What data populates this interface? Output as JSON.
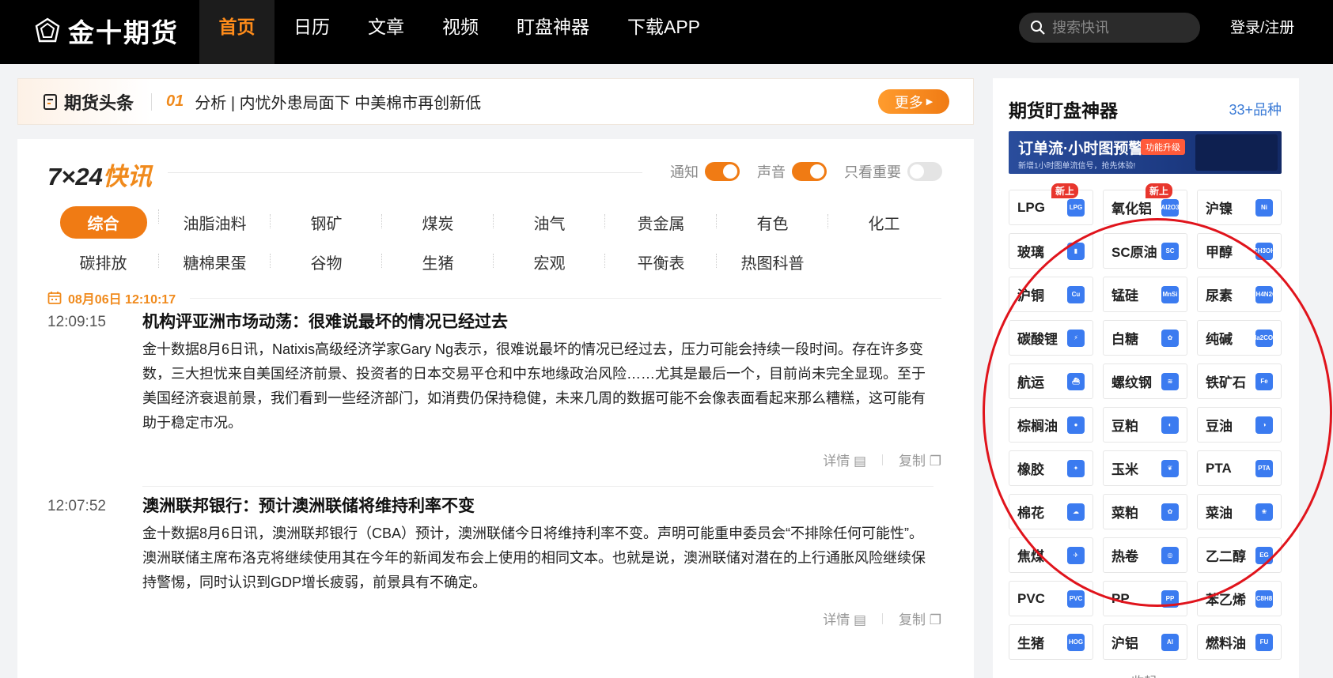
{
  "logo": {
    "text": "金十期货"
  },
  "nav": {
    "items": [
      {
        "label": "首页",
        "active": true
      },
      {
        "label": "日历"
      },
      {
        "label": "文章"
      },
      {
        "label": "视频"
      },
      {
        "label": "盯盘神器"
      },
      {
        "label": "下载APP"
      }
    ]
  },
  "search": {
    "placeholder": "搜索快讯"
  },
  "login": "登录/注册",
  "headline": {
    "label": "期货头条",
    "num": "01",
    "text": "分析 | 内忧外患局面下 中美棉市再创新低",
    "more": "更多"
  },
  "flash": {
    "title_a": "7×24",
    "title_b": "快讯",
    "toggles": [
      {
        "label": "通知",
        "on": true
      },
      {
        "label": "声音",
        "on": true
      },
      {
        "label": "只看重要",
        "on": false
      }
    ],
    "categories_row1": [
      "综合",
      "油脂油料",
      "钢矿",
      "煤炭",
      "油气",
      "贵金属",
      "有色",
      "化工"
    ],
    "categories_row2": [
      "碳排放",
      "糖棉果蛋",
      "谷物",
      "生猪",
      "宏观",
      "平衡表",
      "热图科普"
    ],
    "date": "08月06日 12:10:17",
    "news": [
      {
        "time": "12:09:15",
        "title": "机构评亚洲市场动荡：很难说最坏的情况已经过去",
        "content": "金十数据8月6日讯，Natixis高级经济学家Gary Ng表示，很难说最坏的情况已经过去，压力可能会持续一段时间。存在许多变数，三大担忧来自美国经济前景、投资者的日本交易平仓和中东地缘政治风险……尤其是最后一个，目前尚未完全显现。至于美国经济衰退前景，我们看到一些经济部门，如消费仍保持稳健，未来几周的数据可能不会像表面看起来那么糟糕，这可能有助于稳定市况。",
        "detail": "详情",
        "copy": "复制"
      },
      {
        "time": "12:07:52",
        "title": "澳洲联邦银行：预计澳洲联储将维持利率不变",
        "content": "金十数据8月6日讯，澳洲联邦银行（CBA）预计，澳洲联储今日将维持利率不变。声明可能重申委员会“不排除任何可能性”。澳洲联储主席布洛克将继续使用其在今年的新闻发布会上使用的相同文本。也就是说，澳洲联储对潜在的上行通胀风险继续保持警惕，同时认识到GDP增长疲弱，前景具有不确定。",
        "detail": "详情",
        "copy": "复制"
      }
    ]
  },
  "side": {
    "title": "期货盯盘神器",
    "count": "33+品种",
    "banner": {
      "title": "订单流·小时图预警",
      "tag": "功能升级",
      "sub": "新增1小时图单流信号，抢先体验!"
    },
    "items": [
      {
        "label": "LPG",
        "icon": "LPG",
        "color": "#3b7bf0",
        "new": "新上"
      },
      {
        "label": "氧化铝",
        "icon": "Al2O3",
        "color": "#3b7bf0",
        "new": "新上"
      },
      {
        "label": "沪镍",
        "icon": "Ni",
        "color": "#3b7bf0"
      },
      {
        "label": "玻璃",
        "icon": "▮",
        "color": "#3b7bf0"
      },
      {
        "label": "SC原油",
        "icon": "SC",
        "color": "#3b7bf0"
      },
      {
        "label": "甲醇",
        "icon": "CH3OH",
        "color": "#3b7bf0"
      },
      {
        "label": "沪铜",
        "icon": "Cu",
        "color": "#3b7bf0"
      },
      {
        "label": "锰硅",
        "icon": "MnSi",
        "color": "#3b7bf0"
      },
      {
        "label": "尿素",
        "icon": "CH4N2O",
        "color": "#3b7bf0"
      },
      {
        "label": "碳酸锂",
        "icon": "⚡",
        "color": "#3b7bf0"
      },
      {
        "label": "白糖",
        "icon": "✿",
        "color": "#3b7bf0"
      },
      {
        "label": "纯碱",
        "icon": "Na2CO3",
        "color": "#3b7bf0"
      },
      {
        "label": "航运",
        "icon": "⛴",
        "color": "#3b7bf0"
      },
      {
        "label": "螺纹钢",
        "icon": "≋",
        "color": "#3b7bf0"
      },
      {
        "label": "铁矿石",
        "icon": "Fe",
        "color": "#3b7bf0"
      },
      {
        "label": "棕榈油",
        "icon": "●",
        "color": "#3b7bf0"
      },
      {
        "label": "豆粕",
        "icon": "◐",
        "color": "#3b7bf0"
      },
      {
        "label": "豆油",
        "icon": "◑",
        "color": "#3b7bf0"
      },
      {
        "label": "橡胶",
        "icon": "✦",
        "color": "#3b7bf0"
      },
      {
        "label": "玉米",
        "icon": "❦",
        "color": "#3b7bf0"
      },
      {
        "label": "PTA",
        "icon": "PTA",
        "color": "#3b7bf0"
      },
      {
        "label": "棉花",
        "icon": "☁",
        "color": "#3b7bf0"
      },
      {
        "label": "菜粕",
        "icon": "✿",
        "color": "#3b7bf0"
      },
      {
        "label": "菜油",
        "icon": "❀",
        "color": "#3b7bf0"
      },
      {
        "label": "焦煤",
        "icon": "✈",
        "color": "#3b7bf0"
      },
      {
        "label": "热卷",
        "icon": "◎",
        "color": "#3b7bf0"
      },
      {
        "label": "乙二醇",
        "icon": "EG",
        "color": "#3b7bf0"
      },
      {
        "label": "PVC",
        "icon": "PVC",
        "color": "#3b7bf0"
      },
      {
        "label": "PP",
        "icon": "PP",
        "color": "#3b7bf0"
      },
      {
        "label": "苯乙烯",
        "icon": "C8H8",
        "color": "#3b7bf0"
      },
      {
        "label": "生猪",
        "icon": "HOG",
        "color": "#3b7bf0"
      },
      {
        "label": "沪铝",
        "icon": "Al",
        "color": "#3b7bf0"
      },
      {
        "label": "燃料油",
        "icon": "FU",
        "color": "#3b7bf0"
      }
    ],
    "collapse": "收起"
  },
  "colors": {
    "accent": "#f07b14",
    "link": "#3b7bd6",
    "annotation": "#e0141c"
  }
}
